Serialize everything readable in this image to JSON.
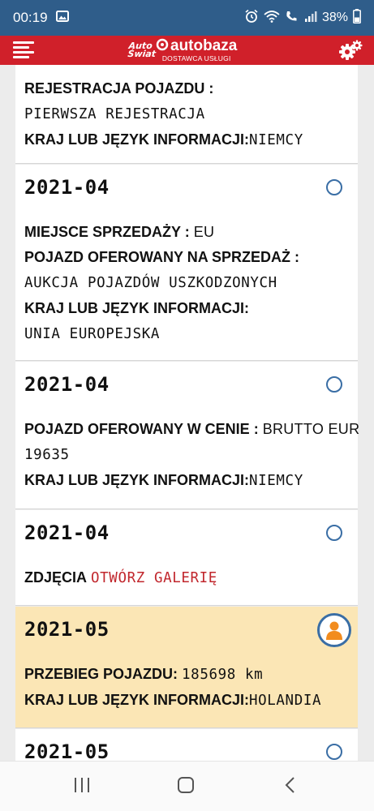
{
  "status_bar": {
    "time": "00:19",
    "battery": "38%",
    "icons": [
      "gallery-icon",
      "alarm-icon",
      "wifi-icon",
      "call-icon",
      "signal-icon",
      "battery-icon"
    ]
  },
  "header": {
    "logo_left_line1": "Auto",
    "logo_left_line2": "Świat",
    "logo_brand": "autobaza",
    "logo_sub": "DOSTAWCA USŁUGI",
    "icons": [
      "menu-icon",
      "gear-icon"
    ]
  },
  "cards": [
    {
      "rows": [
        {
          "label": "REJESTRACJA POJAZDU :"
        },
        {
          "value": "PIERWSZA REJESTRACJA"
        },
        {
          "label": "KRAJ LUB JĘZYK INFORMACJI:",
          "value": "NIEMCY"
        }
      ]
    },
    {
      "date": "2021-04",
      "rows": [
        {
          "label": "MIEJSCE SPRZEDAŻY :",
          "value": "EU"
        },
        {
          "label": "POJAZD OFEROWANY NA SPRZEDAŻ :"
        },
        {
          "value": "AUKCJA POJAZDÓW USZKODZONYCH"
        },
        {
          "label": "KRAJ LUB JĘZYK INFORMACJI:"
        },
        {
          "value": "UNIA EUROPEJSKA"
        }
      ]
    },
    {
      "date": "2021-04",
      "rows": [
        {
          "label": "POJAZD OFEROWANY W CENIE :",
          "value": "BRUTTO EUR"
        },
        {
          "value": "19635"
        },
        {
          "label": "KRAJ LUB JĘZYK INFORMACJI:",
          "value": "NIEMCY"
        }
      ]
    },
    {
      "date": "2021-04",
      "rows": [
        {
          "label": "ZDJĘCIA",
          "link": "OTWÓRZ GALERIĘ"
        }
      ]
    },
    {
      "date": "2021-05",
      "highlight": true,
      "icon": "person-icon",
      "rows": [
        {
          "label": "PRZEBIEG POJAZDU:",
          "value": "185698 km"
        },
        {
          "label": "KRAJ LUB JĘZYK INFORMACJI:",
          "value": "HOLANDIA"
        }
      ]
    },
    {
      "date": "2021-05"
    }
  ],
  "nav_bar": {
    "icons": [
      "recent-apps-icon",
      "home-icon",
      "back-icon"
    ]
  },
  "colors": {
    "status_bar": "#2f5d8a",
    "header": "#d0202a",
    "link": "#c1272d",
    "highlight": "#fbe6b5",
    "radio": "#3a6ea5"
  }
}
